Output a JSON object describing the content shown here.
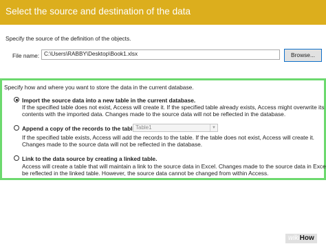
{
  "header": {
    "title": "Select the source and destination of the data"
  },
  "source": {
    "spec_label": "Specify the source of the definition of the objects.",
    "file_name_label": "File name:",
    "file_path": "C:\\Users\\RABBY\\Desktop\\Book1.xlsx",
    "browse_label": "Browse..."
  },
  "storage": {
    "heading": "Specify how and where you want to store the data in the current database.",
    "options": [
      {
        "label": "Import the source data into a new table in the current database.",
        "selected": true,
        "desc": [
          "If the specified table does not exist, Access will create it. If the specified table already exists, Access might overwrite its",
          "contents with the imported data. Changes made to the source data will not be reflected in the database."
        ]
      },
      {
        "label": "Append a copy of the records to the table:",
        "selected": false,
        "table_value": "Table1",
        "desc": [
          "If the specified table exists, Access will add the records to the table. If the table does not exist, Access will create it.",
          "Changes made to the source data will not be reflected in the database."
        ]
      },
      {
        "label": "Link to the data source by creating a linked table.",
        "selected": false,
        "desc": [
          "Access will create a table that will maintain a link to the source data in Excel. Changes made to the source data in Excel will",
          "be reflected in the linked table. However, the source data cannot be changed from within Access."
        ]
      }
    ]
  },
  "watermark": {
    "wiki": "wiki",
    "how": "How"
  },
  "colors": {
    "header": "#dcae1d",
    "highlight_border": "#6cd96e",
    "focus_border": "#0e6fc9"
  }
}
